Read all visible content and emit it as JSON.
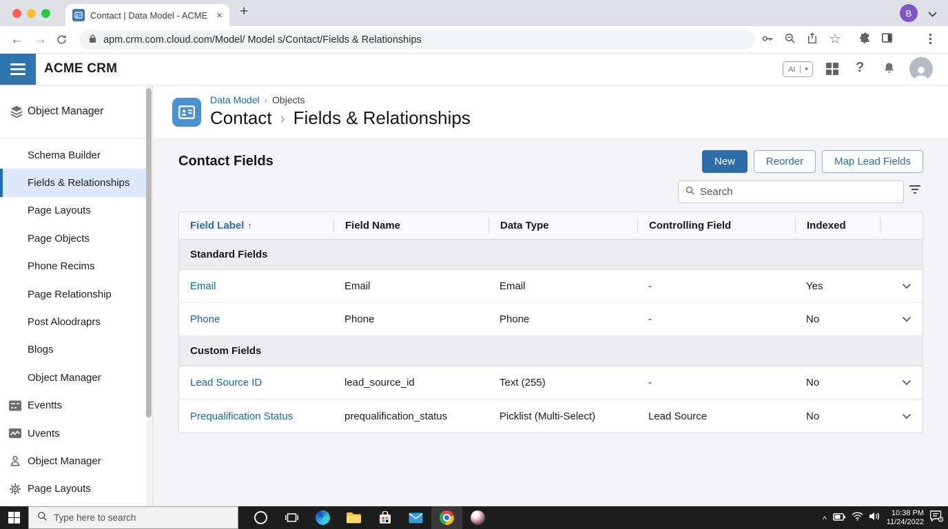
{
  "browser": {
    "tab_title": "Contact | Data Model - ACME",
    "url": "apm.crm.com.cloud.com/Model/ Model s/Contact/Fields & Relationships",
    "profile_initial": "B"
  },
  "icons": {
    "close": "×",
    "new_tab": "+",
    "back": "←",
    "forward": "→",
    "star": "☆",
    "help": "?",
    "ai_label": "AI",
    "ai_caret": "▾",
    "breadcrumb_sep": "›",
    "sort_asc": "↑",
    "tray_chevron": "^"
  },
  "app_header": {
    "brand": "ACME CRM"
  },
  "sidebar": {
    "items": [
      {
        "label": "Object Manager"
      },
      {
        "label": "Schema Builder"
      },
      {
        "label": "Fields & Relationships"
      },
      {
        "label": "Page Layouts"
      },
      {
        "label": "Page Objects"
      },
      {
        "label": "Phone Recims"
      },
      {
        "label": "Page Relationship"
      },
      {
        "label": "Post Aloodraprs"
      },
      {
        "label": "Blogs"
      },
      {
        "label": "Object Manager"
      },
      {
        "label": "Eventts"
      },
      {
        "label": "Uvents"
      },
      {
        "label": "Object Manager"
      },
      {
        "label": "Page Layouts"
      }
    ]
  },
  "breadcrumb": {
    "parent": "Data Model",
    "parent2": "Objects",
    "object": "Contact",
    "section": "Fields & Relationships"
  },
  "main": {
    "heading": "Contact Fields",
    "new_button": "New",
    "reorder_button": "Reorder",
    "map_lead_fields_button": "Map Lead Fields",
    "search_placeholder": "Search"
  },
  "table": {
    "columns": [
      "Field Label",
      "Field Name",
      "Data Type",
      "Controlling Field",
      "Indexed"
    ],
    "sections": [
      {
        "title": "Standard Fields",
        "rows": [
          {
            "field_label": "Email",
            "field_name": "Email",
            "data_type": "Email",
            "controlling_field": "-",
            "indexed": "Yes"
          },
          {
            "field_label": "Phone",
            "field_name": "Phone",
            "data_type": "Phone",
            "controlling_field": "-",
            "indexed": "No"
          }
        ]
      },
      {
        "title": "Custom Fields",
        "rows": [
          {
            "field_label": "Lead Source ID",
            "field_name": "lead_source_id",
            "data_type": "Text (255)",
            "controlling_field": "-",
            "indexed": "No"
          },
          {
            "field_label": "Prequalification Status",
            "field_name": "prequalification_status",
            "data_type": "Picklist (Multi-Select)",
            "controlling_field": "Lead Source",
            "indexed": "No"
          }
        ]
      }
    ]
  },
  "taskbar": {
    "search_placeholder": "Type here to search",
    "time": "10:38 PM",
    "date": "11/24/2022"
  },
  "colors": {
    "header_blue": "#2d76ad",
    "accent_blue": "#2b6da9",
    "link_blue": "#0d6bb7",
    "selected_item_bg": "#dbe9f8"
  }
}
